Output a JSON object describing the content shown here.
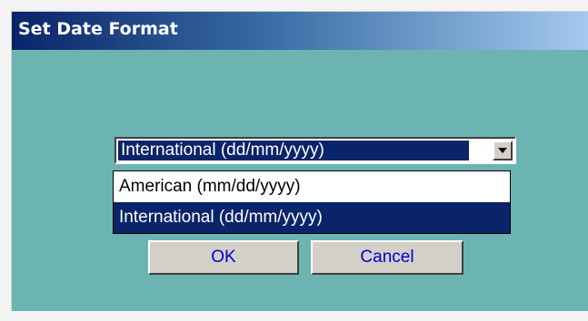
{
  "window": {
    "title": "Set Date Format"
  },
  "date_format": {
    "selected": "International (dd/mm/yyyy)",
    "options": [
      "American (mm/dd/yyyy)",
      "International (dd/mm/yyyy)"
    ],
    "highlighted_index": 1
  },
  "buttons": {
    "ok_label": "OK",
    "cancel_label": "Cancel"
  },
  "colors": {
    "dialog_background": "#6cb4b1",
    "titlebar_start": "#0a246a",
    "titlebar_end": "#a6caf0",
    "selection": "#0a246a",
    "button_face": "#d4d0c8",
    "button_text": "#0000cc"
  },
  "icons": {
    "dropdown": "chevron-down-icon"
  }
}
